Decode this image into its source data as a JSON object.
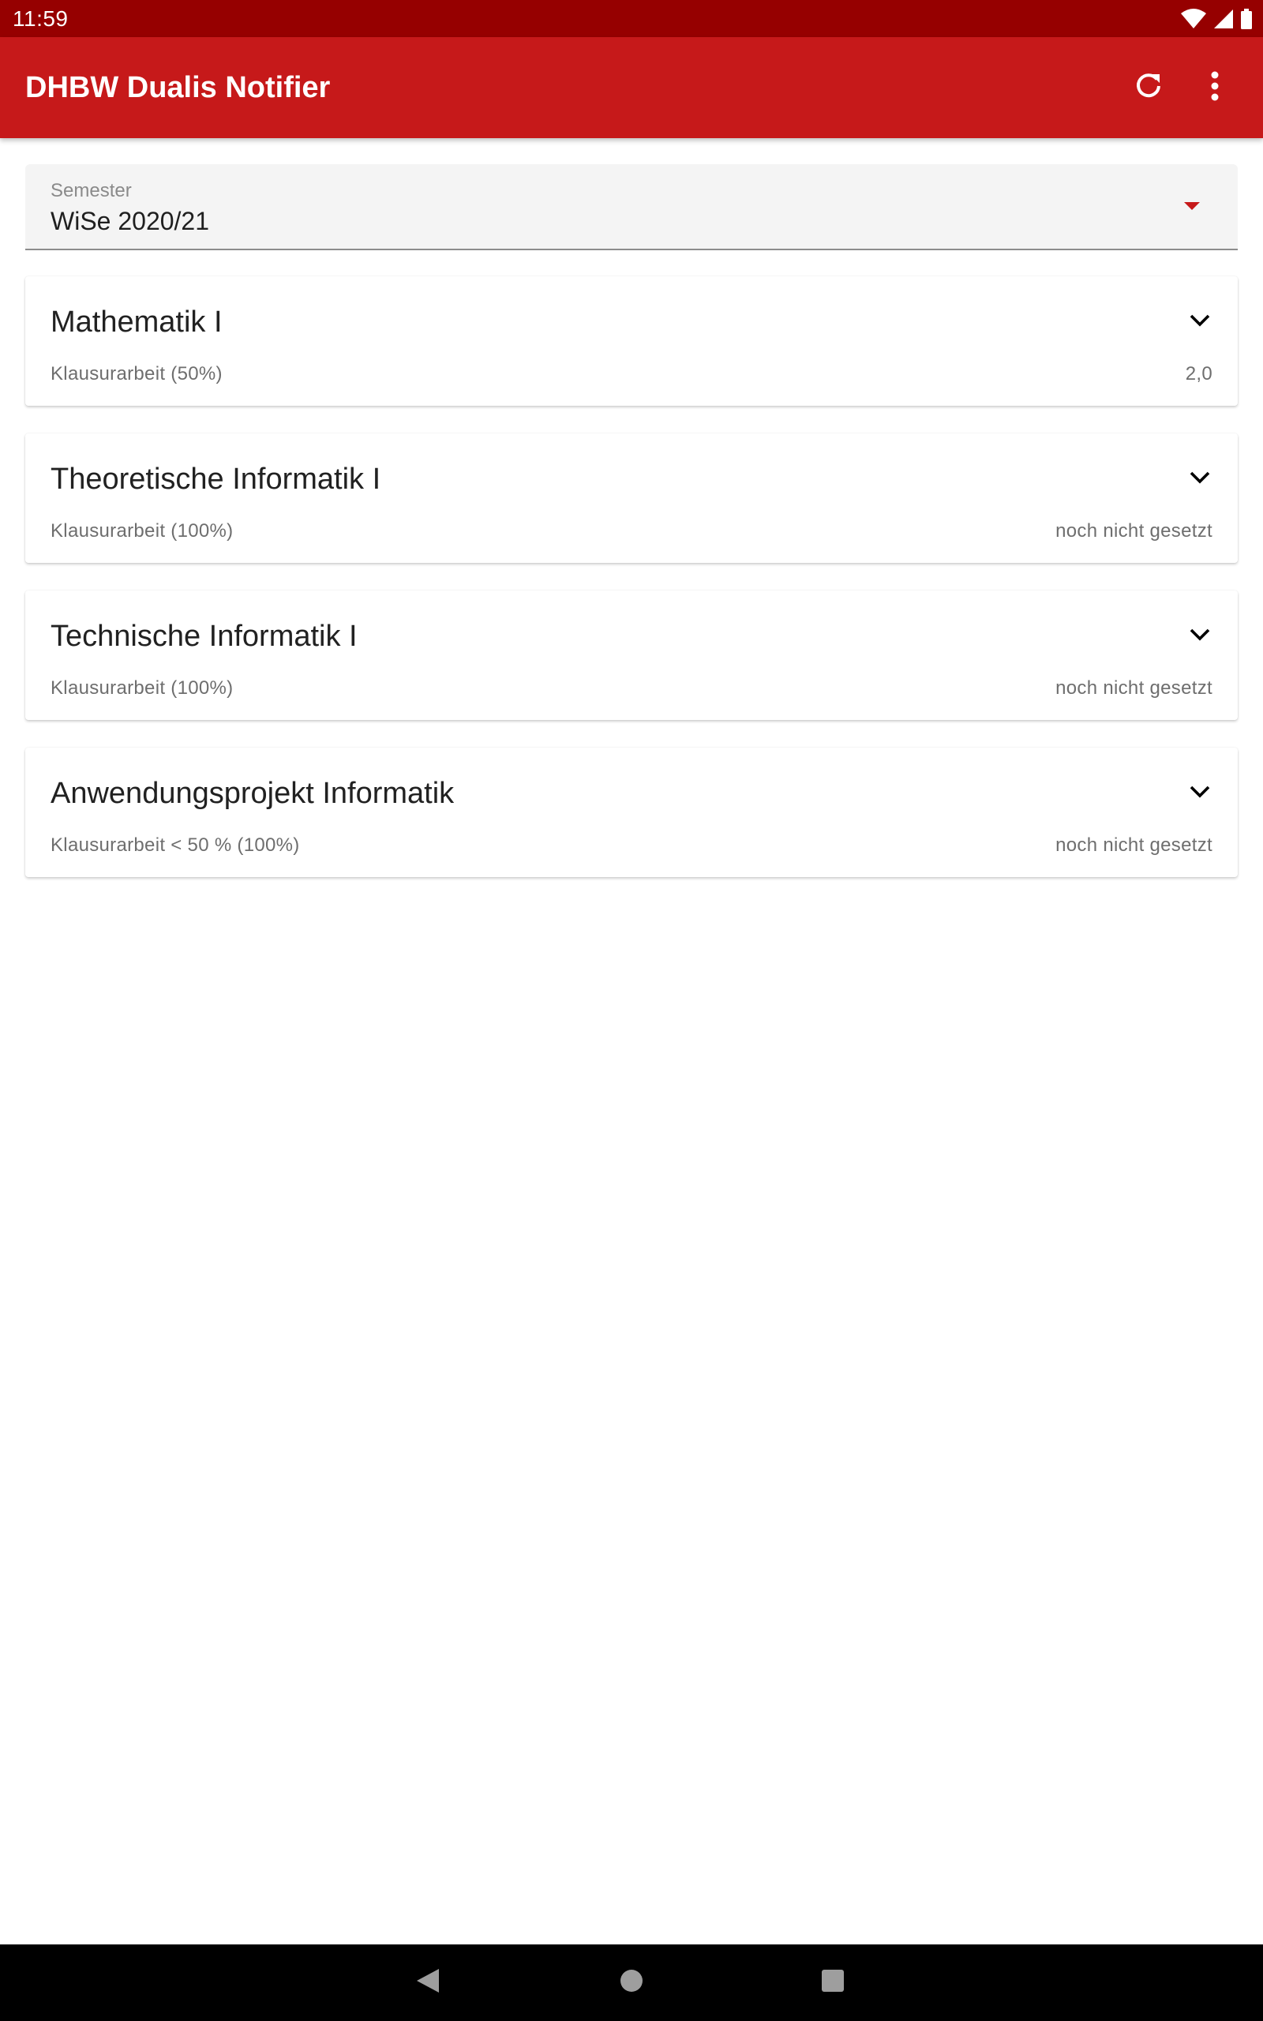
{
  "status_bar": {
    "time": "11:59",
    "icons": [
      "wifi-icon",
      "signal-icon",
      "battery-icon"
    ]
  },
  "app_bar": {
    "title": "DHBW Dualis Notifier",
    "actions": [
      "refresh-icon",
      "more-vert-icon"
    ],
    "background_color": "#c6191a",
    "status_color": "#960000"
  },
  "semester_select": {
    "label": "Semester",
    "value": "WiSe 2020/21"
  },
  "modules": [
    {
      "title": "Mathematik I",
      "exam": "Klausurarbeit (50%)",
      "grade": "2,0"
    },
    {
      "title": "Theoretische Informatik I",
      "exam": "Klausurarbeit (100%)",
      "grade": "noch nicht gesetzt"
    },
    {
      "title": "Technische Informatik I",
      "exam": "Klausurarbeit (100%)",
      "grade": "noch nicht gesetzt"
    },
    {
      "title": "Anwendungsprojekt Informatik",
      "exam": "Klausurarbeit < 50 % (100%)",
      "grade": "noch nicht gesetzt"
    }
  ],
  "nav_bar": {
    "buttons": [
      "back-icon",
      "home-icon",
      "recents-icon"
    ]
  }
}
